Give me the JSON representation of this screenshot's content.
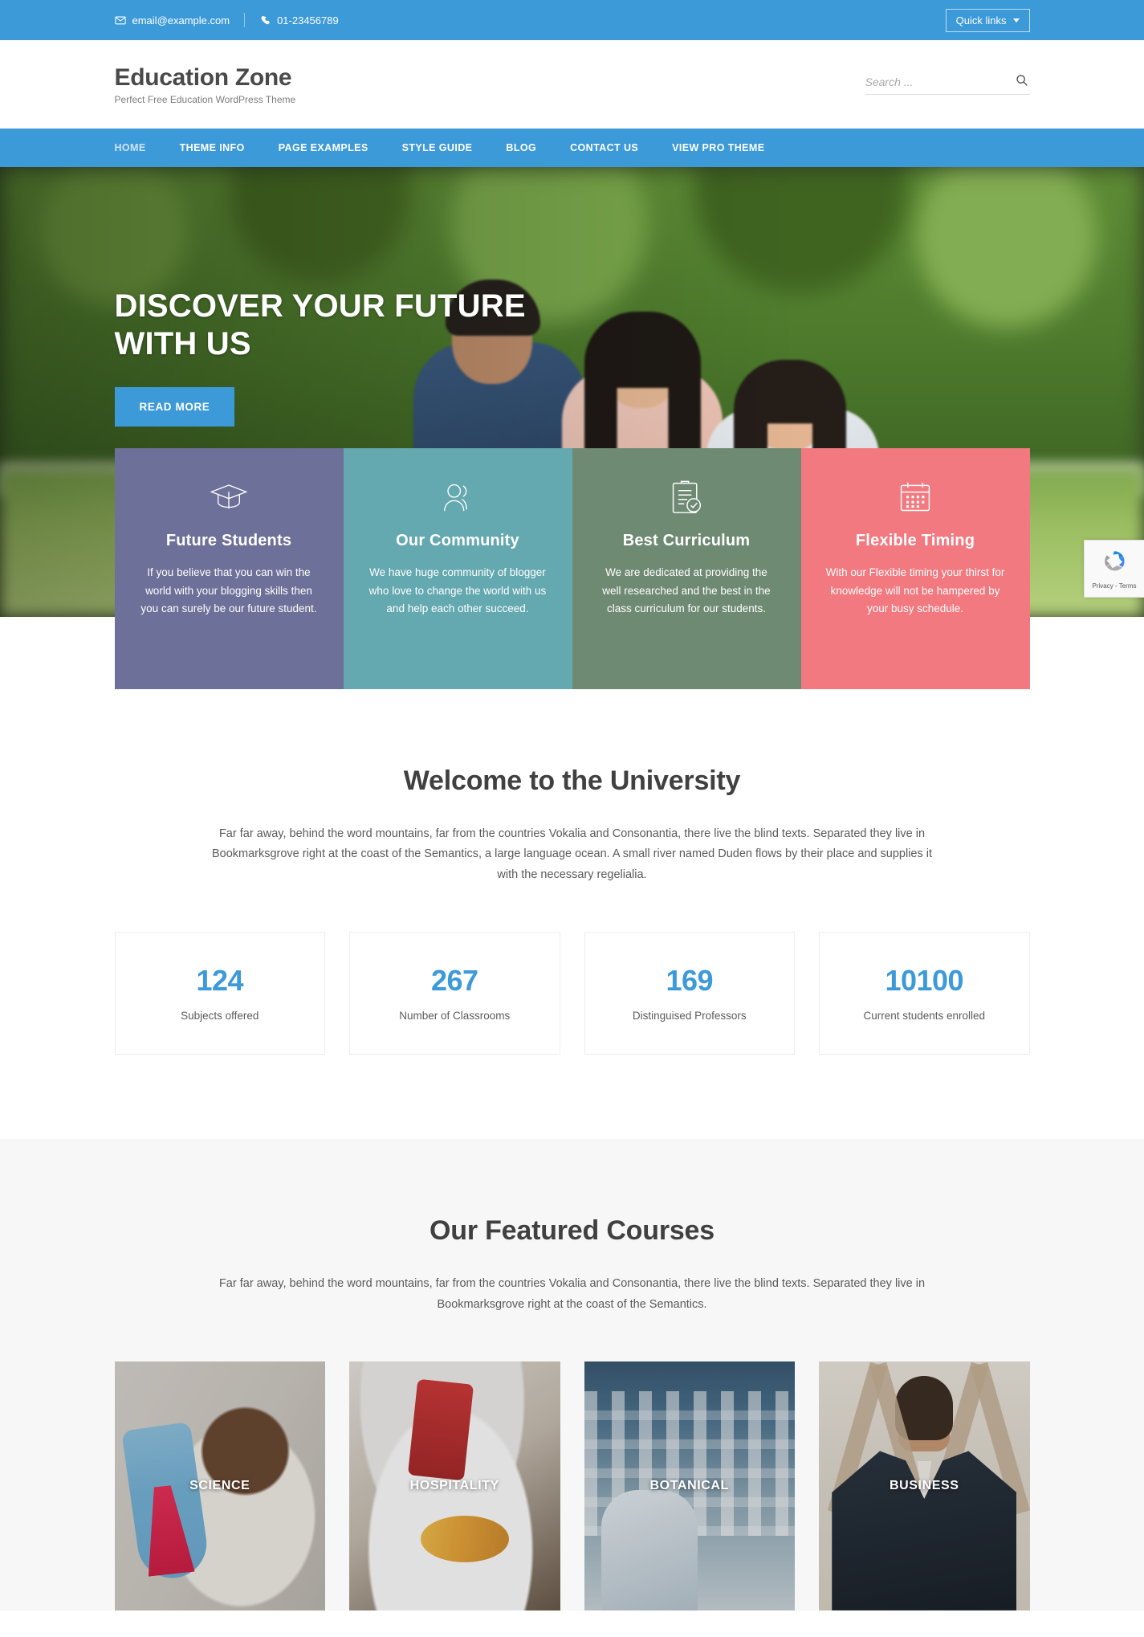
{
  "topbar": {
    "email": "email@example.com",
    "phone": "01-23456789",
    "quick_links_label": "Quick links",
    "email_icon": "envelope-icon",
    "phone_icon": "phone-icon",
    "background_color": "#3d9ad9"
  },
  "header": {
    "site_title": "Education Zone",
    "tagline": "Perfect Free Education WordPress Theme",
    "search_placeholder": "Search ...",
    "search_value": "",
    "search_icon": "search-icon"
  },
  "nav": {
    "items": [
      {
        "label": "HOME",
        "current": true
      },
      {
        "label": "THEME INFO",
        "current": false
      },
      {
        "label": "PAGE EXAMPLES",
        "current": false
      },
      {
        "label": "STYLE GUIDE",
        "current": false
      },
      {
        "label": "BLOG",
        "current": false
      },
      {
        "label": "CONTACT US",
        "current": false
      },
      {
        "label": "VIEW PRO THEME",
        "current": false
      }
    ],
    "background_color": "#3d9ad9"
  },
  "hero": {
    "title": "DISCOVER YOUR FUTURE WITH US",
    "button_label": "READ MORE",
    "button_color": "#3d9ad9"
  },
  "features": [
    {
      "icon": "graduation-cap-icon",
      "title": "Future Students",
      "text": "If you believe that you can win the world with your blogging skills then you can surely be our future student.",
      "color": "#6d7098"
    },
    {
      "icon": "users-icon",
      "title": "Our Community",
      "text": "We have huge community of blogger who love to change the world with us and help each other succeed.",
      "color": "#64a8b0"
    },
    {
      "icon": "clipboard-check-icon",
      "title": "Best Curriculum",
      "text": "We are dedicated at providing the well researched and the best in the class curriculum for our students.",
      "color": "#6f8a73"
    },
    {
      "icon": "calendar-icon",
      "title": "Flexible Timing",
      "text": "With our Flexible timing your thirst for knowledge will not be hampered by your busy schedule.",
      "color": "#f2797f"
    }
  ],
  "welcome": {
    "title": "Welcome to the University",
    "description": "Far far away, behind the word mountains, far from the countries Vokalia and Consonantia, there live the blind texts. Separated they live in Bookmarksgrove right at the coast of the Semantics, a large language ocean. A small river named Duden flows by their place and supplies it with the necessary regelialia.",
    "counters": [
      {
        "number": "124",
        "label": "Subjects offered"
      },
      {
        "number": "267",
        "label": "Number of Classrooms"
      },
      {
        "number": "169",
        "label": "Distinguised Professors"
      },
      {
        "number": "10100",
        "label": "Current students enrolled"
      }
    ],
    "counter_color": "#3d9ad9"
  },
  "courses": {
    "title": "Our Featured Courses",
    "description": "Far far away, behind the word mountains, far from the countries Vokalia and Consonantia, there live the blind texts. Separated they live in Bookmarksgrove right at the coast of the Semantics.",
    "items": [
      {
        "name": "SCIENCE",
        "image": "science-lab-photo"
      },
      {
        "name": "HOSPITALITY",
        "image": "chef-plating-food-photo"
      },
      {
        "name": "BOTANICAL",
        "image": "plant-lab-photo"
      },
      {
        "name": "BUSINESS",
        "image": "businessman-portrait-photo"
      }
    ]
  },
  "recaptcha": {
    "label": "Privacy - Terms",
    "icon": "recaptcha-icon"
  }
}
